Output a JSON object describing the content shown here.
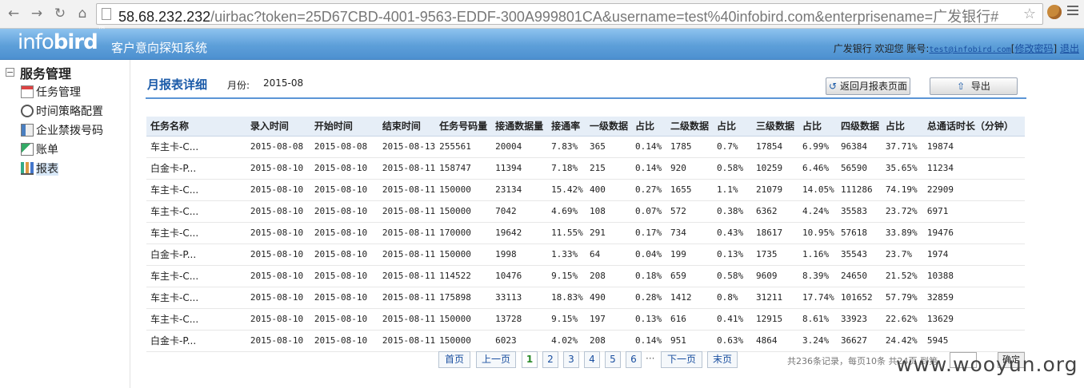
{
  "browser": {
    "url_host": "58.68.232.232",
    "url_rest": "/uirbac?token=25D67CBD-4001-9563-EDDF-300A999801CA&username=test%40infobird.com&enterprisename=广发银行#"
  },
  "header": {
    "logo_light": "info",
    "logo_bold": "bird",
    "logo_tm": "™",
    "system_title": "客户意向探知系统",
    "org": "广发银行",
    "welcome": "欢迎您",
    "account_label": "账号:",
    "account": "test@infobird.com",
    "change_password": "修改密码",
    "logout": "退出"
  },
  "sidebar": {
    "title": "服务管理",
    "items": [
      {
        "label": "任务管理"
      },
      {
        "label": "时间策略配置"
      },
      {
        "label": "企业禁拨号码"
      },
      {
        "label": "账单"
      },
      {
        "label": "报表"
      }
    ]
  },
  "main": {
    "title": "月报表详细",
    "month_label": "月份:",
    "month_value": "2015-08",
    "back_button": "返回月报表页面",
    "export_button": "导出"
  },
  "table": {
    "headers": [
      "任务名称",
      "录入时间",
      "开始时间",
      "结束时间",
      "任务号码量",
      "接通数据量",
      "接通率",
      "一级数据",
      "占比",
      "二级数据",
      "占比",
      "三级数据",
      "占比",
      "四级数据",
      "占比",
      "总通话时长（分钟）"
    ],
    "rows": [
      [
        "车主卡-C...",
        "2015-08-08",
        "2015-08-08",
        "2015-08-13",
        "255561",
        "20004",
        "7.83%",
        "365",
        "0.14%",
        "1785",
        "0.7%",
        "17854",
        "6.99%",
        "96384",
        "37.71%",
        "19874"
      ],
      [
        "白金卡-P...",
        "2015-08-10",
        "2015-08-10",
        "2015-08-11",
        "158747",
        "11394",
        "7.18%",
        "215",
        "0.14%",
        "920",
        "0.58%",
        "10259",
        "6.46%",
        "56590",
        "35.65%",
        "11234"
      ],
      [
        "车主卡-C...",
        "2015-08-10",
        "2015-08-10",
        "2015-08-11",
        "150000",
        "23134",
        "15.42%",
        "400",
        "0.27%",
        "1655",
        "1.1%",
        "21079",
        "14.05%",
        "111286",
        "74.19%",
        "22909"
      ],
      [
        "车主卡-C...",
        "2015-08-10",
        "2015-08-10",
        "2015-08-11",
        "150000",
        "7042",
        "4.69%",
        "108",
        "0.07%",
        "572",
        "0.38%",
        "6362",
        "4.24%",
        "35583",
        "23.72%",
        "6971"
      ],
      [
        "车主卡-C...",
        "2015-08-10",
        "2015-08-10",
        "2015-08-11",
        "170000",
        "19642",
        "11.55%",
        "291",
        "0.17%",
        "734",
        "0.43%",
        "18617",
        "10.95%",
        "57618",
        "33.89%",
        "19476"
      ],
      [
        "白金卡-P...",
        "2015-08-10",
        "2015-08-10",
        "2015-08-11",
        "150000",
        "1998",
        "1.33%",
        "64",
        "0.04%",
        "199",
        "0.13%",
        "1735",
        "1.16%",
        "35543",
        "23.7%",
        "1974"
      ],
      [
        "车主卡-C...",
        "2015-08-10",
        "2015-08-10",
        "2015-08-11",
        "114522",
        "10476",
        "9.15%",
        "208",
        "0.18%",
        "659",
        "0.58%",
        "9609",
        "8.39%",
        "24650",
        "21.52%",
        "10388"
      ],
      [
        "车主卡-C...",
        "2015-08-10",
        "2015-08-10",
        "2015-08-11",
        "175898",
        "33113",
        "18.83%",
        "490",
        "0.28%",
        "1412",
        "0.8%",
        "31211",
        "17.74%",
        "101652",
        "57.79%",
        "32859"
      ],
      [
        "车主卡-C...",
        "2015-08-10",
        "2015-08-10",
        "2015-08-11",
        "150000",
        "13728",
        "9.15%",
        "197",
        "0.13%",
        "616",
        "0.41%",
        "12915",
        "8.61%",
        "33923",
        "22.62%",
        "13629"
      ],
      [
        "白金卡-P...",
        "2015-08-10",
        "2015-08-10",
        "2015-08-11",
        "150000",
        "6023",
        "4.02%",
        "208",
        "0.14%",
        "951",
        "0.63%",
        "4864",
        "3.24%",
        "36627",
        "24.42%",
        "5945"
      ]
    ]
  },
  "pager": {
    "first": "首页",
    "prev": "上一页",
    "pages": [
      "1",
      "2",
      "3",
      "4",
      "5",
      "6"
    ],
    "ellipsis": "···",
    "next": "下一页",
    "last": "末页",
    "info": "共236条记录，每页10条 共24页 到第",
    "goto_value": "",
    "ok": "确定"
  },
  "watermark": "www.wooyun.org"
}
